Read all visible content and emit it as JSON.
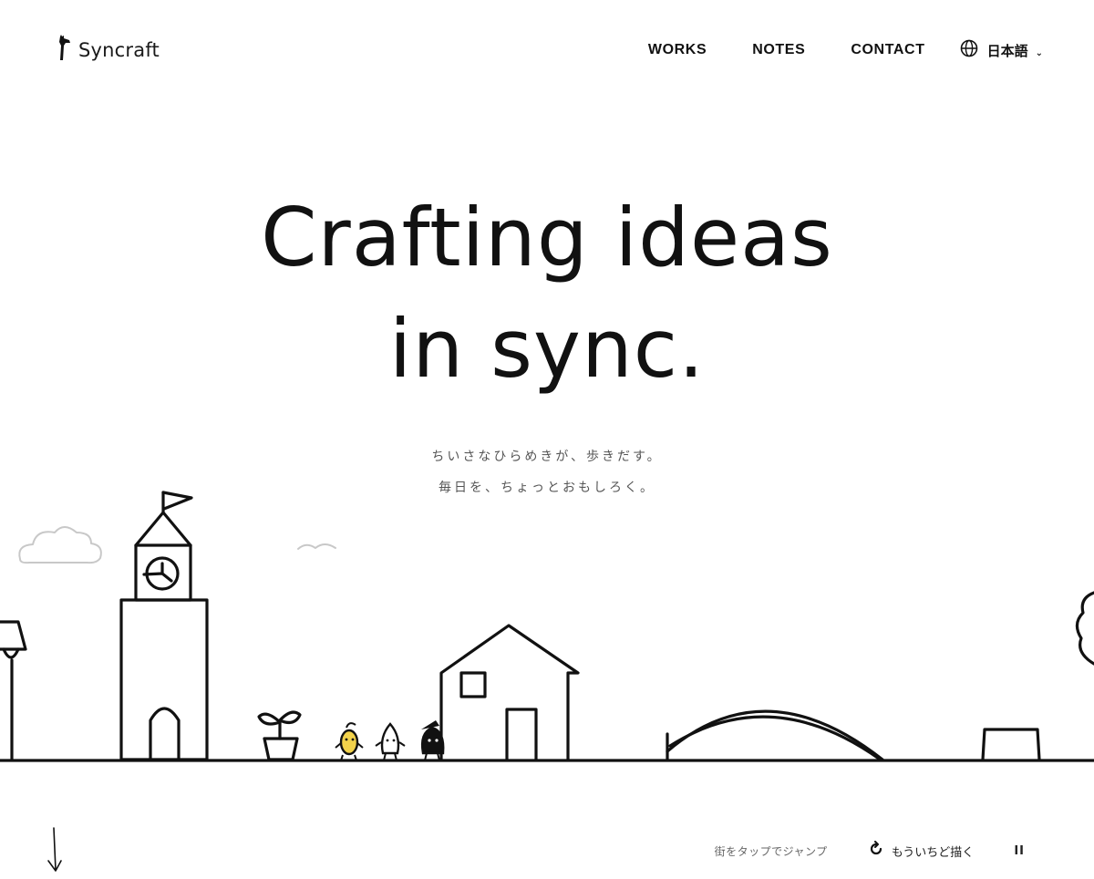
{
  "header": {
    "brand": "Syncraft",
    "nav": [
      {
        "label": "WORKS"
      },
      {
        "label": "NOTES"
      },
      {
        "label": "CONTACT"
      }
    ],
    "language": {
      "label": "日本語",
      "icon": "globe-icon"
    }
  },
  "hero": {
    "title_line1": "Crafting ideas",
    "title_line2": "in sync.",
    "tagline_line1": "ちいさなひらめきが、歩きだす。",
    "tagline_line2": "毎日を、ちょっとおもしろく。"
  },
  "footer_controls": {
    "hint": "街をタップでジャンプ",
    "redraw_label": "もういちど描く",
    "pause_label": "II",
    "scroll_icon": "arrow-down-icon"
  },
  "colors": {
    "ink": "#111111",
    "character_yellow": "#f2d24b",
    "cloud": "#cfcfcf"
  }
}
